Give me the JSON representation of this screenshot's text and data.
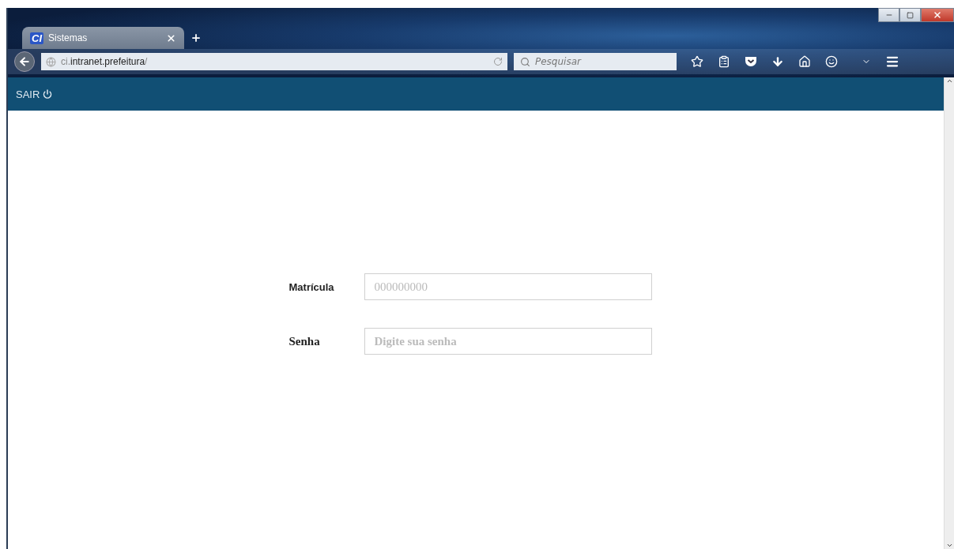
{
  "browser": {
    "tab": {
      "logo": "CI",
      "title": "Sistemas"
    },
    "address": "ci.**intranet.prefeitura**/",
    "search": {
      "placeholder": "Pesquisar"
    }
  },
  "navbar": {
    "logout": "SAIR"
  },
  "form": {
    "fields": [
      {
        "label": "Matrícula",
        "placeholder": "000000000",
        "kind": "text"
      },
      {
        "label": "Senha",
        "placeholder": "Digite sua senha",
        "kind": "password"
      }
    ]
  }
}
